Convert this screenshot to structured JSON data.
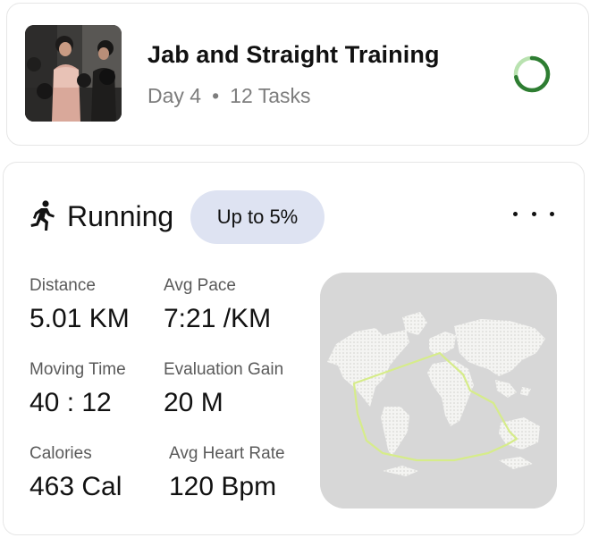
{
  "training": {
    "title": "Jab and Straight Training",
    "day": "Day 4",
    "separator": "•",
    "tasks": "12 Tasks",
    "progress": 0.72,
    "progress_color": "#2e7d32",
    "progress_track_color": "#b9e2b0"
  },
  "running": {
    "label": "Running",
    "badge": "Up to 5%",
    "badge_color": "#dee3f2",
    "stats": {
      "distance": {
        "label": "Distance",
        "value": "5.01 KM"
      },
      "avg_pace": {
        "label": "Avg Pace",
        "value": "7:21 /KM"
      },
      "moving_time": {
        "label": "Moving Time",
        "value": "40 : 12"
      },
      "evaluation_gain": {
        "label": "Evaluation Gain",
        "value": "20 M"
      },
      "calories": {
        "label": "Calories",
        "value": "463 Cal"
      },
      "avg_heart_rate": {
        "label": "Avg Heart Rate",
        "value": "120 Bpm"
      }
    },
    "route_color": "#d6ec8a"
  },
  "icons": {
    "progress": "progress-ring-icon",
    "running": "running-person-icon",
    "more": "more-horizontal-icon"
  }
}
